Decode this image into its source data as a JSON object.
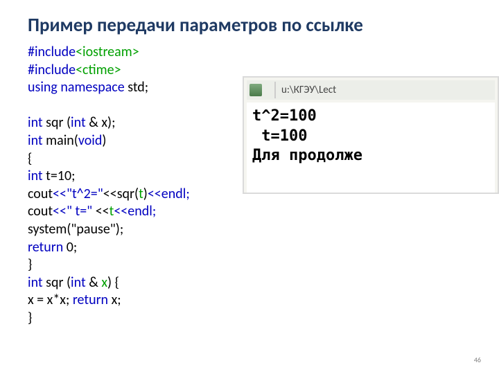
{
  "title": "Пример передачи параметров по ссылке",
  "code": {
    "l1a": "#include",
    "l1b": "<iostream>",
    "l2a": "#include",
    "l2b": "<ctime>",
    "l3a": "using namespace ",
    "l3b": "std;",
    "l4a": "int",
    "l4b": " sqr (",
    "l4c": "int",
    "l4d": " & x);",
    "l5a": "int",
    "l5b": " main(",
    "l5c": "void",
    "l5d": ")",
    "l6": "{",
    "l7a": "int",
    "l7b": " t=10;",
    "l8a": "cout",
    "l8b": "<<\"t^2=\"",
    "l8c": "<<sqr(",
    "l8d": "t",
    "l8e": ")",
    "l8f": "<<endl;",
    "l9a": "cout",
    "l9b": "<<\" t=\" ",
    "l9c": "<<",
    "l9d": "t",
    "l9e": "<<endl;",
    "l10": "system(\"pause\");",
    "l11a": "return",
    "l11b": " 0;",
    "l12": "}",
    "l13a": "int",
    "l13b": " sqr (",
    "l13c": "int",
    "l13d": " & ",
    "l13e": "x",
    "l13f": ") {",
    "l14a": "x = x*x; ",
    "l14b": "return",
    "l14c": " x;",
    "l15": "}"
  },
  "console": {
    "titlebar": "u:\\КГЭУ\\Lect",
    "line1": "t^2=100",
    "line2": " t=100",
    "line3": "Для продолже"
  },
  "pagenum": "46"
}
